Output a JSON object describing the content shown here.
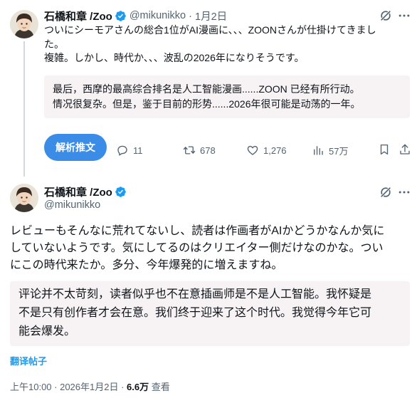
{
  "tweet1": {
    "author_name": "石橋和章 /Zoo",
    "handle": "@mikunikko",
    "date": "1月2日",
    "text_lines": [
      "ついにシーモアさんの総合1位がAI漫画に、、、ZOONさんが仕掛けてきまし",
      "た。",
      "複雑。しかし、時代か、、、波乱の2026年になりそうです。"
    ],
    "translation_lines": [
      "最后，西摩的最高综合排名是人工智能漫画......ZOON 已经有所行动。",
      "情况很复杂。但是，鉴于目前的形势......2026年很可能是动荡的一年。"
    ],
    "translate_button": "解析推文",
    "stats": {
      "replies": "11",
      "retweets": "678",
      "likes": "1,276",
      "views": "57万"
    }
  },
  "tweet2": {
    "author_name": "石橋和章 /Zoo",
    "handle": "@mikunikko",
    "text_lines": [
      "レビューもそんなに荒れてないし、読者は作画者がAIかどうかなんか気に",
      "していないようです。気にしてるのはクリエイター側だけなのかな。つい",
      "にこの時代来たか。多分、今年爆発的に増えますね。"
    ],
    "translation_lines": [
      "评论并不太苛刻，读者似乎也不在意插画师是不是人工智能。我怀疑是",
      "不是只有创作者才会在意。我们终于迎来了这个时代。我觉得今年它可",
      "能会爆发。"
    ],
    "translate_link": "翻译帖子",
    "timestamp": "上午10:00 · 2026年1月2日 · ",
    "views_count": "6.6万",
    "views_label": " 查看"
  },
  "colors": {
    "accent": "#1d9bf0",
    "translate_button_bg": "#3b8ce6",
    "translation_bg": "#f7f2f4",
    "secondary_text": "#536471"
  },
  "icons": [
    "grok-icon",
    "more-icon",
    "verified-badge-icon",
    "reply-icon",
    "retweet-icon",
    "like-icon",
    "views-icon",
    "bookmark-icon",
    "share-icon"
  ]
}
